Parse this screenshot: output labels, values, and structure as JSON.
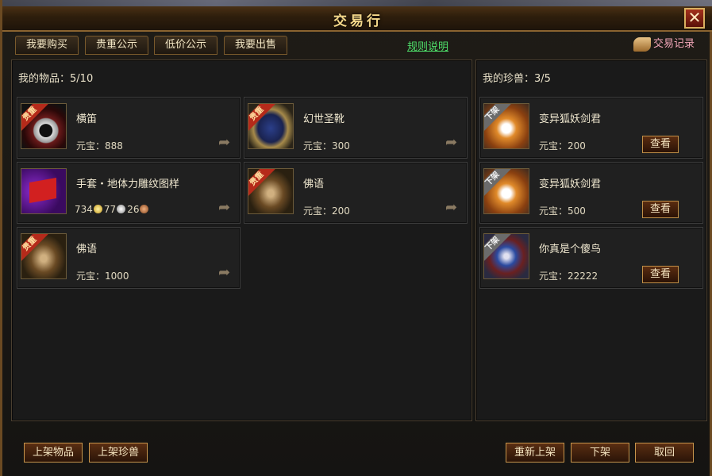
{
  "window": {
    "title": "交易行"
  },
  "tabs": [
    {
      "label": "我要购买"
    },
    {
      "label": "贵重公示"
    },
    {
      "label": "低价公示"
    },
    {
      "label": "我要出售"
    }
  ],
  "rules_link": "规则说明",
  "trade_record": "交易记录",
  "left_panel": {
    "header_label": "我的物品：",
    "header_count": "5/10",
    "price_label": "元宝：",
    "items": [
      {
        "name": "横笛",
        "price": "888",
        "badge": "贵重",
        "icon": "ring-icon"
      },
      {
        "name": "幻世圣靴",
        "price": "300",
        "badge": "贵重",
        "icon": "boot-icon"
      },
      {
        "name": "手套・地体力雕纹图样",
        "gold": "734",
        "silver": "77",
        "copper": "26",
        "icon": "flag-icon"
      },
      {
        "name": "佛语",
        "price": "200",
        "badge": "贵重",
        "icon": "shoe-icon"
      },
      {
        "name": "佛语",
        "price": "1000",
        "badge": "贵重",
        "icon": "shoe-icon"
      }
    ]
  },
  "right_panel": {
    "header_label": "我的珍兽：",
    "header_count": "3/5",
    "price_label": "元宝：",
    "view_label": "查看",
    "pets": [
      {
        "name": "变异狐妖剑君",
        "price": "200",
        "badge": "下架",
        "icon": "fox-icon"
      },
      {
        "name": "变异狐妖剑君",
        "price": "500",
        "badge": "下架",
        "icon": "fox-icon"
      },
      {
        "name": "你真是个傻鸟",
        "price": "22222",
        "badge": "下架",
        "icon": "bird-icon"
      }
    ]
  },
  "buttons": {
    "list_item": "上架物品",
    "list_pet": "上架珍兽",
    "relist": "重新上架",
    "delist": "下架",
    "cancel": "取回"
  },
  "colors": {
    "accent": "#c8964c",
    "link": "#4ee06a",
    "badge_valuable": "#b52a1a",
    "badge_off": "#6b6b6b"
  }
}
